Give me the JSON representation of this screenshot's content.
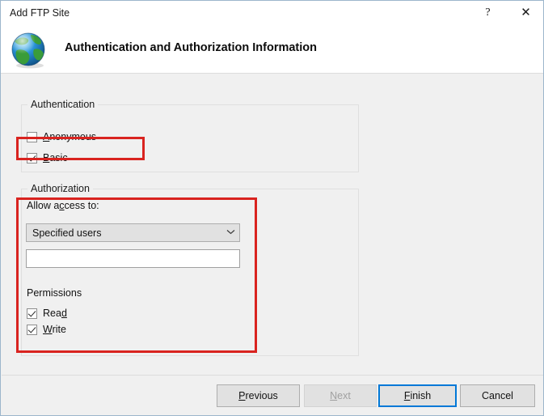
{
  "window": {
    "title": "Add FTP Site",
    "help_glyph": "?",
    "close_glyph": "✕"
  },
  "header": {
    "title": "Authentication and Authorization Information",
    "icon": "globe-icon"
  },
  "authentication": {
    "group_label": "Authentication",
    "options": [
      {
        "label_pre": "",
        "accel": "A",
        "label_post": "nonymous",
        "checked": false
      },
      {
        "label_pre": "",
        "accel": "B",
        "label_post": "asic",
        "checked": true
      }
    ]
  },
  "authorization": {
    "group_label": "Authorization",
    "allow_access_label_pre": "Allow a",
    "allow_access_accel": "c",
    "allow_access_label_post": "cess to:",
    "combo": {
      "value": "Specified users",
      "arrow": "⌄"
    },
    "users_field": {
      "value": "",
      "placeholder": ""
    },
    "permissions_label": "Permissions",
    "permissions": [
      {
        "label_pre": "Rea",
        "accel": "d",
        "label_post": "",
        "checked": true
      },
      {
        "label_pre": "",
        "accel": "W",
        "label_post": "rite",
        "checked": true
      }
    ]
  },
  "footer": {
    "buttons": [
      {
        "id": "previous",
        "label_pre": "",
        "accel": "P",
        "label_post": "revious",
        "disabled": false,
        "default": false
      },
      {
        "id": "next",
        "label_pre": "",
        "accel": "N",
        "label_post": "ext",
        "disabled": true,
        "default": false
      },
      {
        "id": "finish",
        "label_pre": "",
        "accel": "F",
        "label_post": "inish",
        "disabled": false,
        "default": true
      },
      {
        "id": "cancel",
        "label_pre": "Cancel",
        "accel": "",
        "label_post": "",
        "disabled": false,
        "default": false
      }
    ]
  },
  "annotations": {
    "highlight_color": "#d9231f",
    "boxes": [
      {
        "name": "basic-checkbox-highlight"
      },
      {
        "name": "authorization-section-highlight"
      }
    ]
  }
}
